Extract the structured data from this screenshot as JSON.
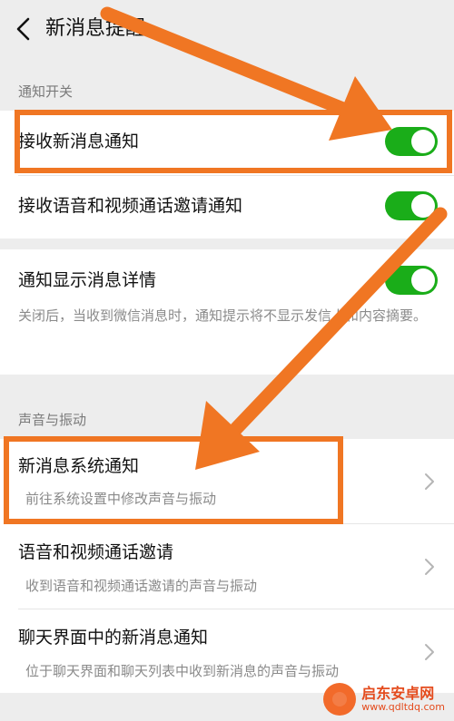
{
  "header": {
    "title": "新消息提醒",
    "back_icon": "chevron-left-icon"
  },
  "sections": {
    "notify_switch": "通知开关",
    "sound_vibration": "声音与振动"
  },
  "notify": {
    "receive_new": {
      "label": "接收新消息通知",
      "on": true
    },
    "receive_call": {
      "label": "接收语音和视频通话邀请通知",
      "on": true
    },
    "show_detail": {
      "label": "通知显示消息详情",
      "on": true,
      "desc": "关闭后，当收到微信消息时，通知提示将不显示发信人和内容摘要。"
    }
  },
  "sound": {
    "system": {
      "label": "新消息系统通知",
      "sub": "前往系统设置中修改声音与振动"
    },
    "call": {
      "label": "语音和视频通话邀请",
      "sub": "收到语音和视频通话邀请的声音与振动"
    },
    "chat": {
      "label": "聊天界面中的新消息通知",
      "sub": "位于聊天界面和聊天列表中收到新消息的声音与振动"
    }
  },
  "watermark": {
    "name": "启东安卓网",
    "url": "www.qdltdq.com"
  },
  "colors": {
    "toggle_on": "#1aad19",
    "highlight": "#f07623"
  }
}
